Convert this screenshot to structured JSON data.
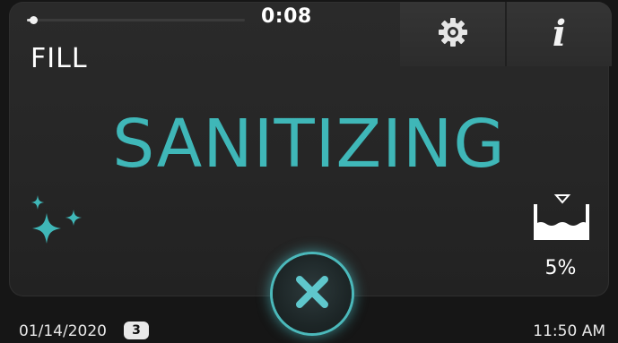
{
  "cycle": {
    "progress_fraction": 0.03,
    "timer": "0:08",
    "phase": "FILL",
    "status": "SANITIZING"
  },
  "controls": {
    "settings_icon": "gear-icon",
    "info_icon": "info-icon",
    "info_glyph": "i",
    "cancel_icon": "close-icon"
  },
  "water_level": {
    "icon": "basin-fill-icon",
    "percent_label": "5%"
  },
  "footer": {
    "date": "01/14/2020",
    "badge": "3",
    "time": "11:50 AM"
  },
  "colors": {
    "accent": "#3fb7b8",
    "background": "#262626",
    "text": "#ffffff"
  }
}
